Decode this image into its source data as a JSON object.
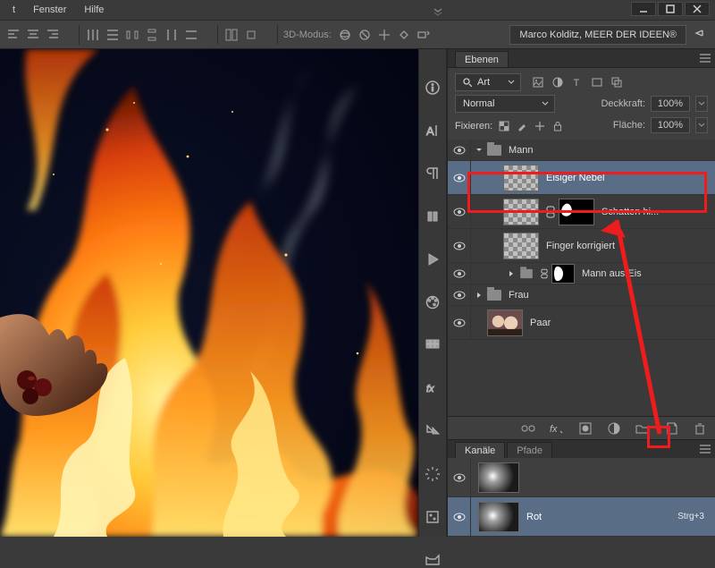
{
  "menu": {
    "items": [
      "t",
      "Fenster",
      "Hilfe"
    ]
  },
  "options": {
    "mode3d_label": "3D-Modus:",
    "user": "Marco Kolditz, MEER DER IDEEN®"
  },
  "panel_layers": {
    "tab": "Ebenen",
    "filter_label": "Art",
    "blend_mode": "Normal",
    "opacity_label": "Deckkraft:",
    "opacity_value": "100%",
    "lock_label": "Fixieren:",
    "fill_label": "Fläche:",
    "fill_value": "100%",
    "layers": [
      {
        "name": "Mann",
        "type": "group",
        "depth": 0,
        "open": true
      },
      {
        "name": "Eisiger Nebel",
        "type": "layer",
        "depth": 1,
        "selected": true
      },
      {
        "name": "Schatten hi...",
        "type": "masked",
        "depth": 1
      },
      {
        "name": "Finger korrigiert",
        "type": "layer",
        "depth": 1
      },
      {
        "name": "Mann aus Eis",
        "type": "group-collapsed",
        "depth": 1,
        "mask": true
      },
      {
        "name": "Frau",
        "type": "group-collapsed",
        "depth": 0
      },
      {
        "name": "Paar",
        "type": "layer-image",
        "depth": 1
      }
    ]
  },
  "panel_channels": {
    "tabs": [
      "Kanäle",
      "Pfade"
    ],
    "channel_name": "Rot",
    "channel_shortcut": "Strg+3"
  }
}
